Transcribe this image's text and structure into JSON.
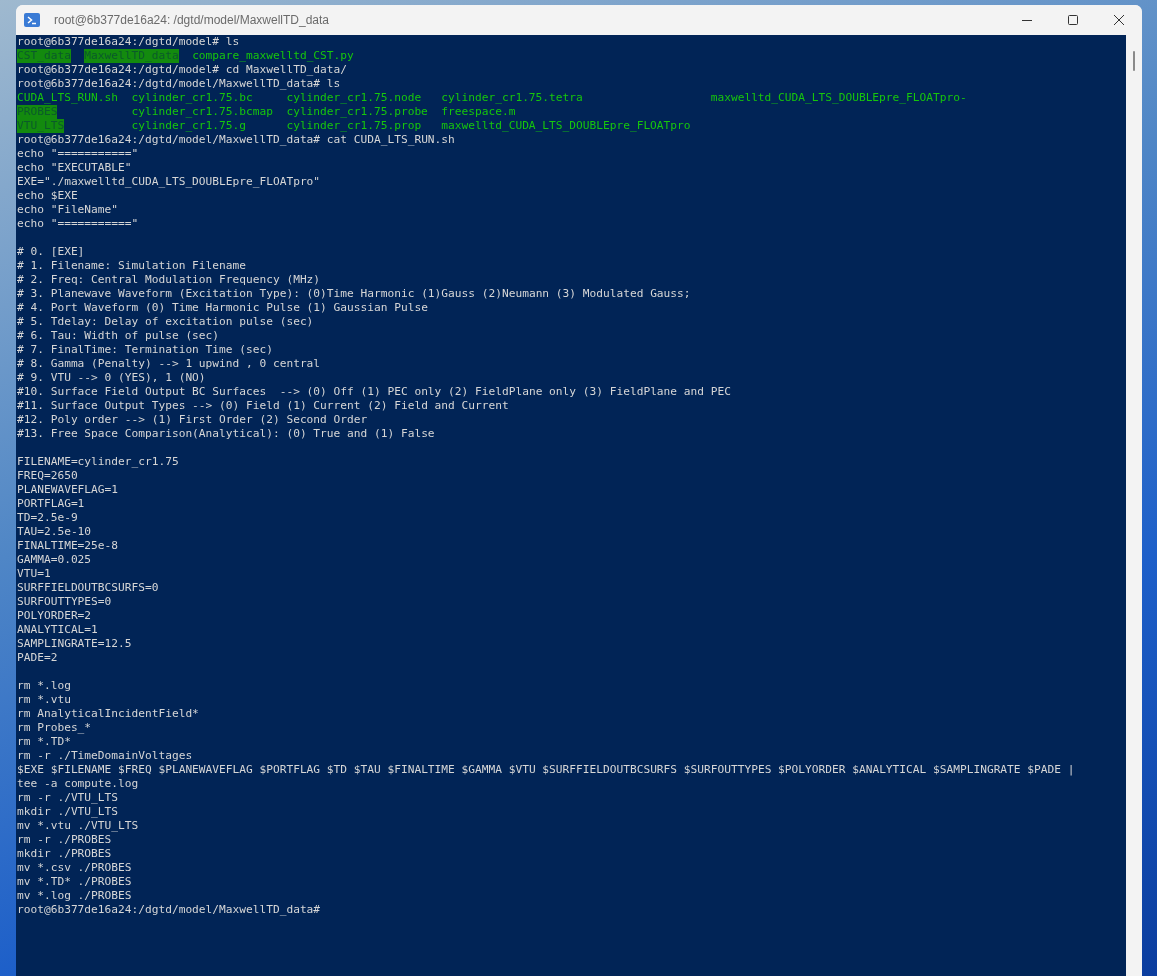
{
  "window": {
    "title": "root@6b377de16a24: /dgtd/model/MaxwellTD_data"
  },
  "terminal": {
    "lines": [
      {
        "kind": "text",
        "text": "root@6b377de16a24:/dgtd/model# ls"
      },
      {
        "kind": "ls-inline",
        "entries": [
          {
            "name": "CST_data",
            "directory": true
          },
          {
            "name": "MaxwellTD_data",
            "directory": true
          },
          {
            "name": "compare_maxwelltd_CST.py",
            "directory": false
          }
        ]
      },
      {
        "kind": "text",
        "text": "root@6b377de16a24:/dgtd/model# cd MaxwellTD_data/"
      },
      {
        "kind": "text",
        "text": "root@6b377de16a24:/dgtd/model/MaxwellTD_data# ls"
      },
      {
        "kind": "ls-grid",
        "entries": [
          {
            "name": "CUDA_LTS_RUN.sh",
            "directory": false
          },
          {
            "name": "cylinder_cr1.75.bc",
            "directory": false
          },
          {
            "name": "cylinder_cr1.75.node",
            "directory": false
          },
          {
            "name": "cylinder_cr1.75.tetra",
            "directory": false
          },
          {
            "name": "maxwelltd_CUDA_LTS_DOUBLEpre_FLOATpro-",
            "directory": false
          }
        ]
      },
      {
        "kind": "ls-grid",
        "entries": [
          {
            "name": "PROBES",
            "directory": true
          },
          {
            "name": "cylinder_cr1.75.bcmap",
            "directory": false
          },
          {
            "name": "cylinder_cr1.75.probe",
            "directory": false
          },
          {
            "name": "freespace.m",
            "directory": false
          }
        ]
      },
      {
        "kind": "ls-grid",
        "entries": [
          {
            "name": "VTU_LTS",
            "directory": true
          },
          {
            "name": "cylinder_cr1.75.g",
            "directory": false
          },
          {
            "name": "cylinder_cr1.75.prop",
            "directory": false
          },
          {
            "name": "maxwelltd_CUDA_LTS_DOUBLEpre_FLOATpro",
            "directory": false
          }
        ]
      },
      {
        "kind": "text",
        "text": "root@6b377de16a24:/dgtd/model/MaxwellTD_data# cat CUDA_LTS_RUN.sh"
      },
      {
        "kind": "text",
        "text": "echo \"===========\""
      },
      {
        "kind": "text",
        "text": "echo \"EXECUTABLE\""
      },
      {
        "kind": "text",
        "text": "EXE=\"./maxwelltd_CUDA_LTS_DOUBLEpre_FLOATpro\""
      },
      {
        "kind": "text",
        "text": "echo $EXE"
      },
      {
        "kind": "text",
        "text": "echo \"FileName\""
      },
      {
        "kind": "text",
        "text": "echo \"===========\""
      },
      {
        "kind": "blank"
      },
      {
        "kind": "text",
        "text": "# 0. [EXE]"
      },
      {
        "kind": "text",
        "text": "# 1. Filename: Simulation Filename"
      },
      {
        "kind": "text",
        "text": "# 2. Freq: Central Modulation Frequency (MHz)"
      },
      {
        "kind": "text",
        "text": "# 3. Planewave Waveform (Excitation Type): (0)Time Harmonic (1)Gauss (2)Neumann (3) Modulated Gauss;"
      },
      {
        "kind": "text",
        "text": "# 4. Port Waveform (0) Time Harmonic Pulse (1) Gaussian Pulse"
      },
      {
        "kind": "text",
        "text": "# 5. Tdelay: Delay of excitation pulse (sec)"
      },
      {
        "kind": "text",
        "text": "# 6. Tau: Width of pulse (sec)"
      },
      {
        "kind": "text",
        "text": "# 7. FinalTime: Termination Time (sec)"
      },
      {
        "kind": "text",
        "text": "# 8. Gamma (Penalty) --> 1 upwind , 0 central"
      },
      {
        "kind": "text",
        "text": "# 9. VTU --> 0 (YES), 1 (NO)"
      },
      {
        "kind": "text",
        "text": "#10. Surface Field Output BC Surfaces  --> (0) Off (1) PEC only (2) FieldPlane only (3) FieldPlane and PEC"
      },
      {
        "kind": "text",
        "text": "#11. Surface Output Types --> (0) Field (1) Current (2) Field and Current"
      },
      {
        "kind": "text",
        "text": "#12. Poly order --> (1) First Order (2) Second Order"
      },
      {
        "kind": "text",
        "text": "#13. Free Space Comparison(Analytical): (0) True and (1) False"
      },
      {
        "kind": "blank"
      },
      {
        "kind": "text",
        "text": "FILENAME=cylinder_cr1.75"
      },
      {
        "kind": "text",
        "text": "FREQ=2650"
      },
      {
        "kind": "text",
        "text": "PLANEWAVEFLAG=1"
      },
      {
        "kind": "text",
        "text": "PORTFLAG=1"
      },
      {
        "kind": "text",
        "text": "TD=2.5e-9"
      },
      {
        "kind": "text",
        "text": "TAU=2.5e-10"
      },
      {
        "kind": "text",
        "text": "FINALTIME=25e-8"
      },
      {
        "kind": "text",
        "text": "GAMMA=0.025"
      },
      {
        "kind": "text",
        "text": "VTU=1"
      },
      {
        "kind": "text",
        "text": "SURFFIELDOUTBCSURFS=0"
      },
      {
        "kind": "text",
        "text": "SURFOUTTYPES=0"
      },
      {
        "kind": "text",
        "text": "POLYORDER=2"
      },
      {
        "kind": "text",
        "text": "ANALYTICAL=1"
      },
      {
        "kind": "text",
        "text": "SAMPLINGRATE=12.5"
      },
      {
        "kind": "text",
        "text": "PADE=2"
      },
      {
        "kind": "blank"
      },
      {
        "kind": "text",
        "text": "rm *.log"
      },
      {
        "kind": "text",
        "text": "rm *.vtu"
      },
      {
        "kind": "text",
        "text": "rm AnalyticalIncidentField*"
      },
      {
        "kind": "text",
        "text": "rm Probes_*"
      },
      {
        "kind": "text",
        "text": "rm *.TD*"
      },
      {
        "kind": "text",
        "text": "rm -r ./TimeDomainVoltages"
      },
      {
        "kind": "text",
        "text": "$EXE $FILENAME $FREQ $PLANEWAVEFLAG $PORTFLAG $TD $TAU $FINALTIME $GAMMA $VTU $SURFFIELDOUTBCSURFS $SURFOUTTYPES $POLYORDER $ANALYTICAL $SAMPLINGRATE $PADE |"
      },
      {
        "kind": "text",
        "text": "tee -a compute.log"
      },
      {
        "kind": "text",
        "text": "rm -r ./VTU_LTS"
      },
      {
        "kind": "text",
        "text": "mkdir ./VTU_LTS"
      },
      {
        "kind": "text",
        "text": "mv *.vtu ./VTU_LTS"
      },
      {
        "kind": "text",
        "text": "rm -r ./PROBES"
      },
      {
        "kind": "text",
        "text": "mkdir ./PROBES"
      },
      {
        "kind": "text",
        "text": "mv *.csv ./PROBES"
      },
      {
        "kind": "text",
        "text": "mv *.TD* ./PROBES"
      },
      {
        "kind": "text",
        "text": "mv *.log ./PROBES"
      },
      {
        "kind": "text",
        "text": "root@6b377de16a24:/dgtd/model/MaxwellTD_data#"
      }
    ]
  }
}
